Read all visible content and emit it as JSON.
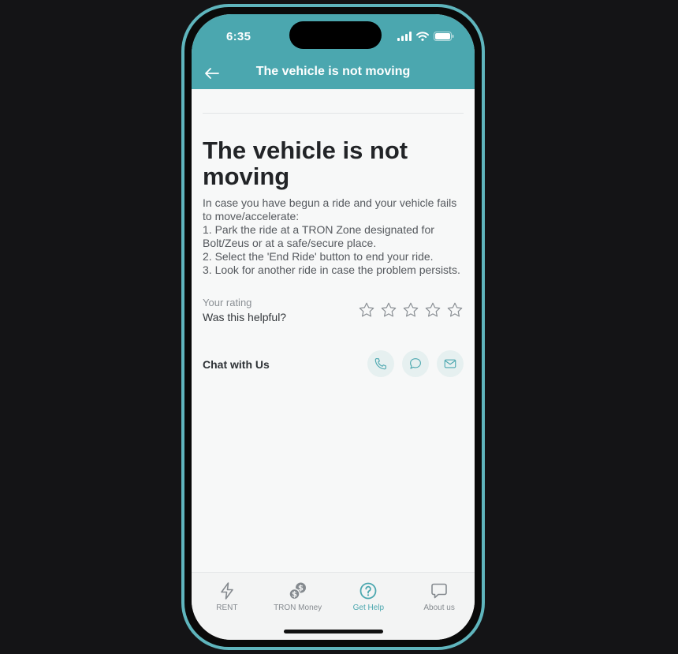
{
  "status_bar": {
    "time": "6:35"
  },
  "header": {
    "title": "The vehicle is not moving"
  },
  "article": {
    "title": "The vehicle is not moving",
    "lines": [
      "In case you have begun a ride and your vehicle fails to move/accelerate:",
      "1. Park the ride at a TRON Zone designated for Bolt/Zeus or at a safe/secure place.",
      "2. Select the 'End Ride' button to end your ride.",
      "3. Look for another ride in case the problem persists."
    ]
  },
  "rating": {
    "label": "Your rating",
    "question": "Was this helpful?",
    "stars_total": 5,
    "stars_selected": 0
  },
  "chat": {
    "label": "Chat with Us",
    "buttons": [
      "phone-icon",
      "chat-bubble-icon",
      "mail-icon"
    ]
  },
  "tabbar": {
    "items": [
      {
        "label": "RENT",
        "icon": "lightning-icon"
      },
      {
        "label": "TRON Money",
        "icon": "coins-icon"
      },
      {
        "label": "Get Help",
        "icon": "help-circle-icon"
      },
      {
        "label": "About us",
        "icon": "speech-bubble-icon"
      }
    ],
    "active": "Get Help"
  },
  "colors": {
    "accent": "#4ba7af",
    "frame": "#5fb5bd",
    "background": "#141416"
  }
}
